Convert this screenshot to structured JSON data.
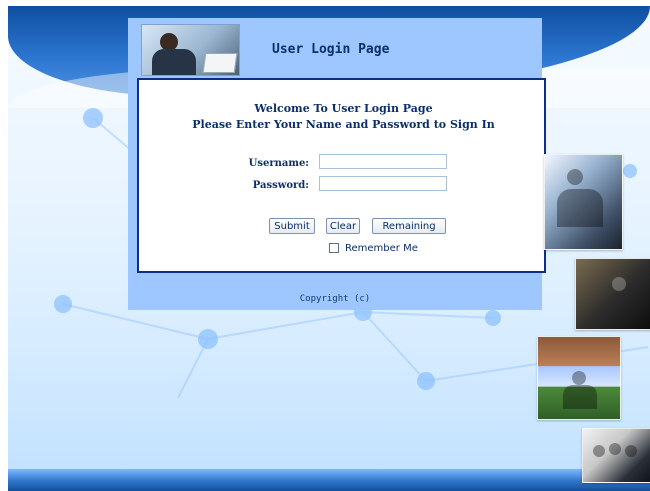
{
  "colors": {
    "panel": "#9ec6ff",
    "login_border": "#0b2f8a",
    "title_text": "#0a2f6b",
    "top_band": "#2b74cf"
  },
  "header": {
    "title": "User Login Page"
  },
  "login": {
    "welcome_line_1": "Welcome To User Login Page",
    "welcome_line_2": "Please Enter Your Name and Password to Sign In",
    "username_label": "Username:",
    "password_label": "Password:",
    "username_value": "",
    "password_value": "",
    "buttons": {
      "submit": "Submit",
      "clear": "Clear",
      "remaining": "Remaining"
    },
    "remember_me_label": "Remember Me",
    "remember_me_checked": false
  },
  "footer": {
    "copyright": "Copyright (c)"
  },
  "icons": {
    "checkbox": "checkbox-icon"
  }
}
